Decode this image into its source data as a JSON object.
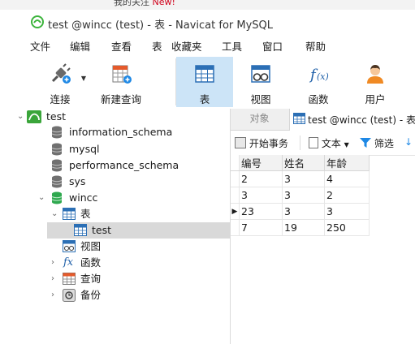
{
  "top_strip": {
    "text": "我的关注 ",
    "new_badge": "New!"
  },
  "window": {
    "title": "test @wincc (test) - 表 - Navicat for MySQL"
  },
  "menu": [
    "文件",
    "编辑",
    "查看",
    "表",
    "收藏夹",
    "工具",
    "窗口",
    "帮助"
  ],
  "toolbar": {
    "connect": "连接",
    "new_query": "新建查询",
    "table": "表",
    "view": "视图",
    "function": "函数",
    "user": "用户"
  },
  "tree": {
    "connection": "test",
    "databases": [
      "information_schema",
      "mysql",
      "performance_schema",
      "sys"
    ],
    "open_db": "wincc",
    "tables_label": "表",
    "table_item": "test",
    "views_label": "视图",
    "functions_label": "函数",
    "queries_label": "查询",
    "backups_label": "备份"
  },
  "tabs": {
    "objects": "对象",
    "active": "test @wincc (test) - 表"
  },
  "subtoolbar": {
    "begin_transaction": "开始事务",
    "text": "文本",
    "filter": "筛选"
  },
  "grid": {
    "columns": [
      "编号",
      "姓名",
      "年龄"
    ],
    "rows": [
      [
        "2",
        "3",
        "4"
      ],
      [
        "3",
        "3",
        "2"
      ],
      [
        "23",
        "3",
        "3"
      ],
      [
        "7",
        "19",
        "250"
      ]
    ],
    "current_row_index": 2
  },
  "colors": {
    "accent": "#0078d7",
    "selected_tool": "#cce4f7",
    "db_icon": "#2fa84f",
    "logo": "#3cb43c"
  }
}
